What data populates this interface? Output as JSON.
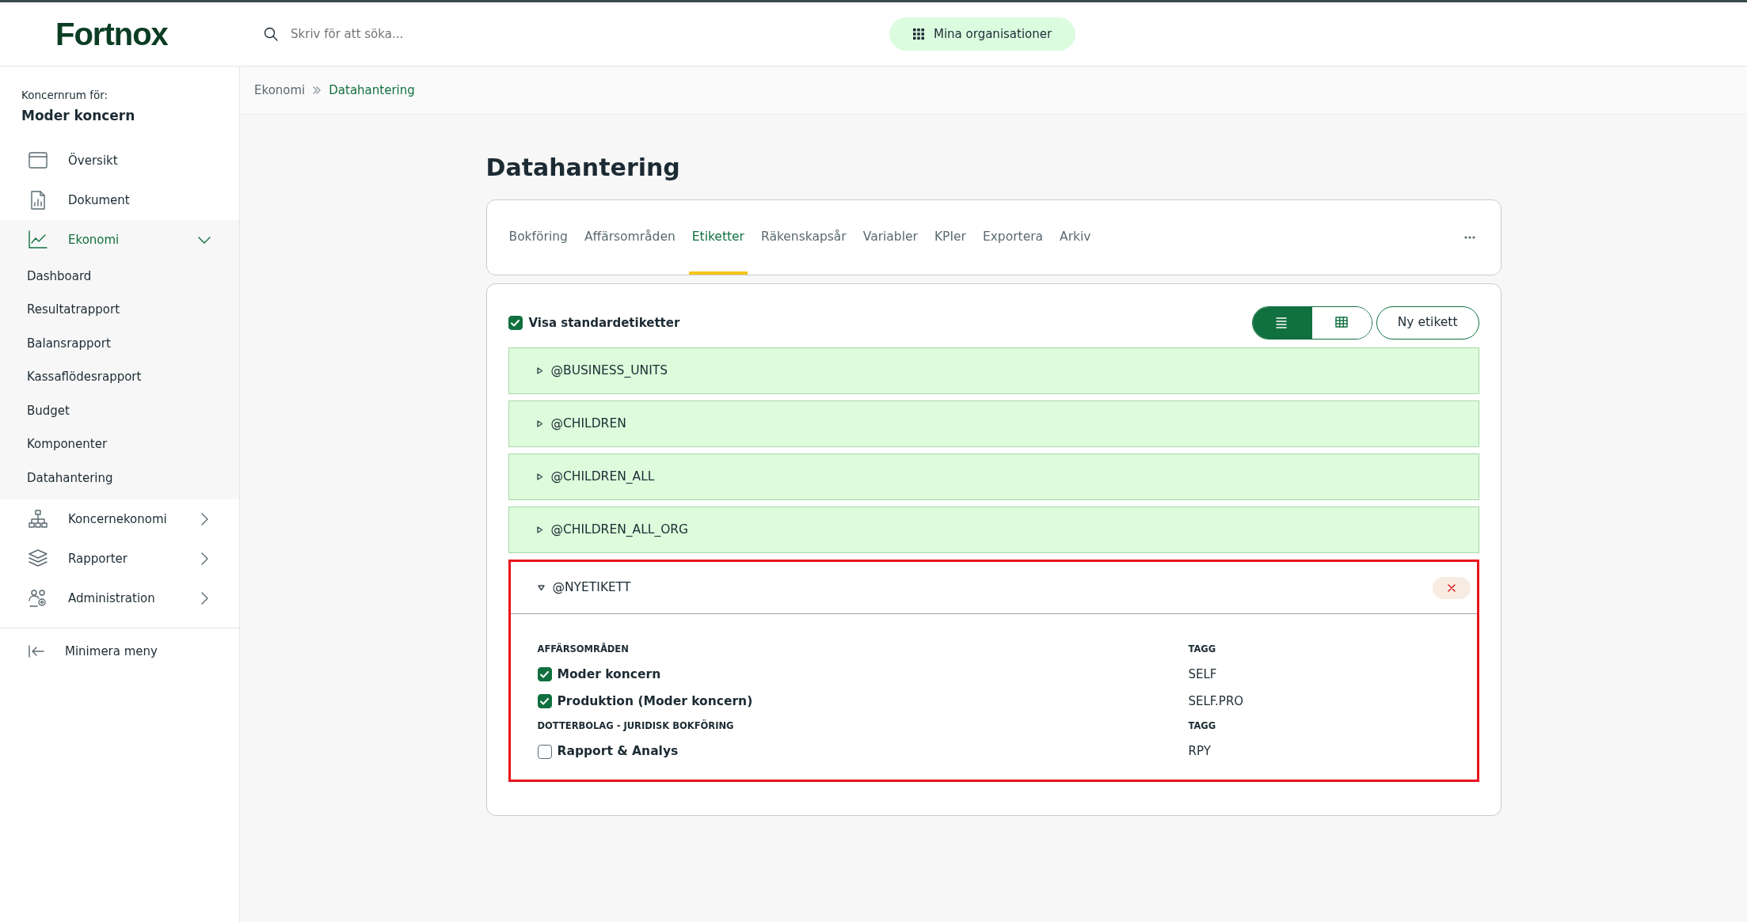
{
  "header": {
    "logo": "Fortnox",
    "search": {
      "placeholder": "Skriv för att söka..."
    },
    "org_button": "Mina organisationer"
  },
  "sidebar": {
    "caption": "Koncernrum för:",
    "org": "Moder koncern",
    "items": [
      {
        "label": "Översikt",
        "kind": "window",
        "selected": false
      },
      {
        "label": "Dokument",
        "kind": "document",
        "selected": false
      },
      {
        "label": "Ekonomi",
        "kind": "chart",
        "selected": true,
        "expanded": true,
        "children": [
          {
            "label": "Dashboard"
          },
          {
            "label": "Resultatrapport"
          },
          {
            "label": "Balansrapport"
          },
          {
            "label": "Kassaflödesrapport"
          },
          {
            "label": "Budget"
          },
          {
            "label": "Komponenter"
          },
          {
            "label": "Datahantering"
          }
        ]
      },
      {
        "label": "Koncernekonomi",
        "kind": "hierarchy",
        "selected": false,
        "expanded": false
      },
      {
        "label": "Rapporter",
        "kind": "layers",
        "selected": false,
        "expanded": false
      },
      {
        "label": "Administration",
        "kind": "users",
        "selected": false,
        "expanded": false
      }
    ],
    "collapse": "Minimera meny"
  },
  "breadcrumb": [
    "Ekonomi",
    "Datahantering"
  ],
  "title": "Datahantering",
  "tabs": [
    {
      "label": "Bokföring",
      "selected": false
    },
    {
      "label": "Affärsområden",
      "selected": false
    },
    {
      "label": "Etiketter",
      "selected": true
    },
    {
      "label": "Räkenskapsår",
      "selected": false
    },
    {
      "label": "Variabler",
      "selected": false
    },
    {
      "label": "KPIer",
      "selected": false
    },
    {
      "label": "Exportera",
      "selected": false
    },
    {
      "label": "Arkiv",
      "selected": false
    }
  ],
  "toolbar": {
    "checkbox": {
      "label": "Visa standardetiketter",
      "checked": true
    },
    "views": [
      {
        "kind": "list",
        "selected": true
      },
      {
        "kind": "grid",
        "selected": false
      }
    ],
    "new_button": "Ny etikett"
  },
  "labels": [
    {
      "name": "@BUSINESS_UNITS",
      "expanded": false
    },
    {
      "name": "@CHILDREN",
      "expanded": false
    },
    {
      "name": "@CHILDREN_ALL",
      "expanded": false
    },
    {
      "name": "@CHILDREN_ALL_ORG",
      "expanded": false
    },
    {
      "name": "@NYETIKETT",
      "expanded": true,
      "highlighted": true,
      "sections": [
        {
          "heading": "AFFÄRSOMRÅDEN",
          "tag_heading": "TAGG",
          "rows": [
            {
              "label": "Moder koncern",
              "checked": true,
              "tag": "SELF"
            },
            {
              "label": "Produktion (Moder koncern)",
              "checked": true,
              "tag": "SELF.PRO"
            }
          ]
        },
        {
          "heading": "DOTTERBOLAG - JURIDISK BOKFÖRING",
          "tag_heading": "TAGG",
          "rows": [
            {
              "label": "Rapport & Analys",
              "checked": false,
              "tag": "RPY"
            }
          ]
        }
      ]
    }
  ]
}
